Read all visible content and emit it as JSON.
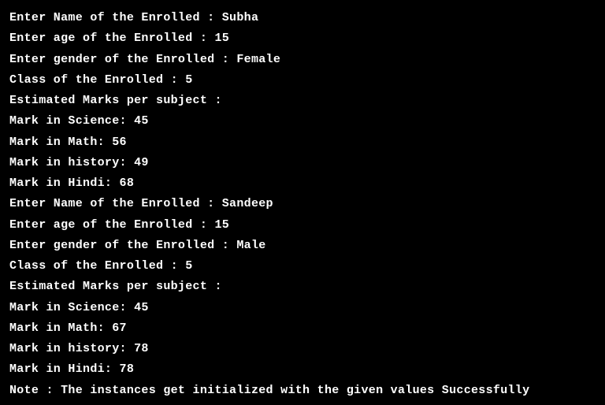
{
  "lines": [
    "Enter Name of the Enrolled : Subha",
    "Enter age of the Enrolled : 15",
    "Enter gender of the Enrolled : Female",
    "Class of the Enrolled : 5",
    "Estimated Marks per subject :",
    "Mark in Science: 45",
    "Mark in Math: 56",
    "Mark in history: 49",
    "Mark in Hindi: 68",
    "Enter Name of the Enrolled : Sandeep",
    "Enter age of the Enrolled : 15",
    "Enter gender of the Enrolled : Male",
    "Class of the Enrolled : 5",
    "Estimated Marks per subject :",
    "Mark in Science: 45",
    "Mark in Math: 67",
    "Mark in history: 78",
    "Mark in Hindi: 78",
    "",
    "Note : The instances get initialized with the given values Successfully"
  ]
}
